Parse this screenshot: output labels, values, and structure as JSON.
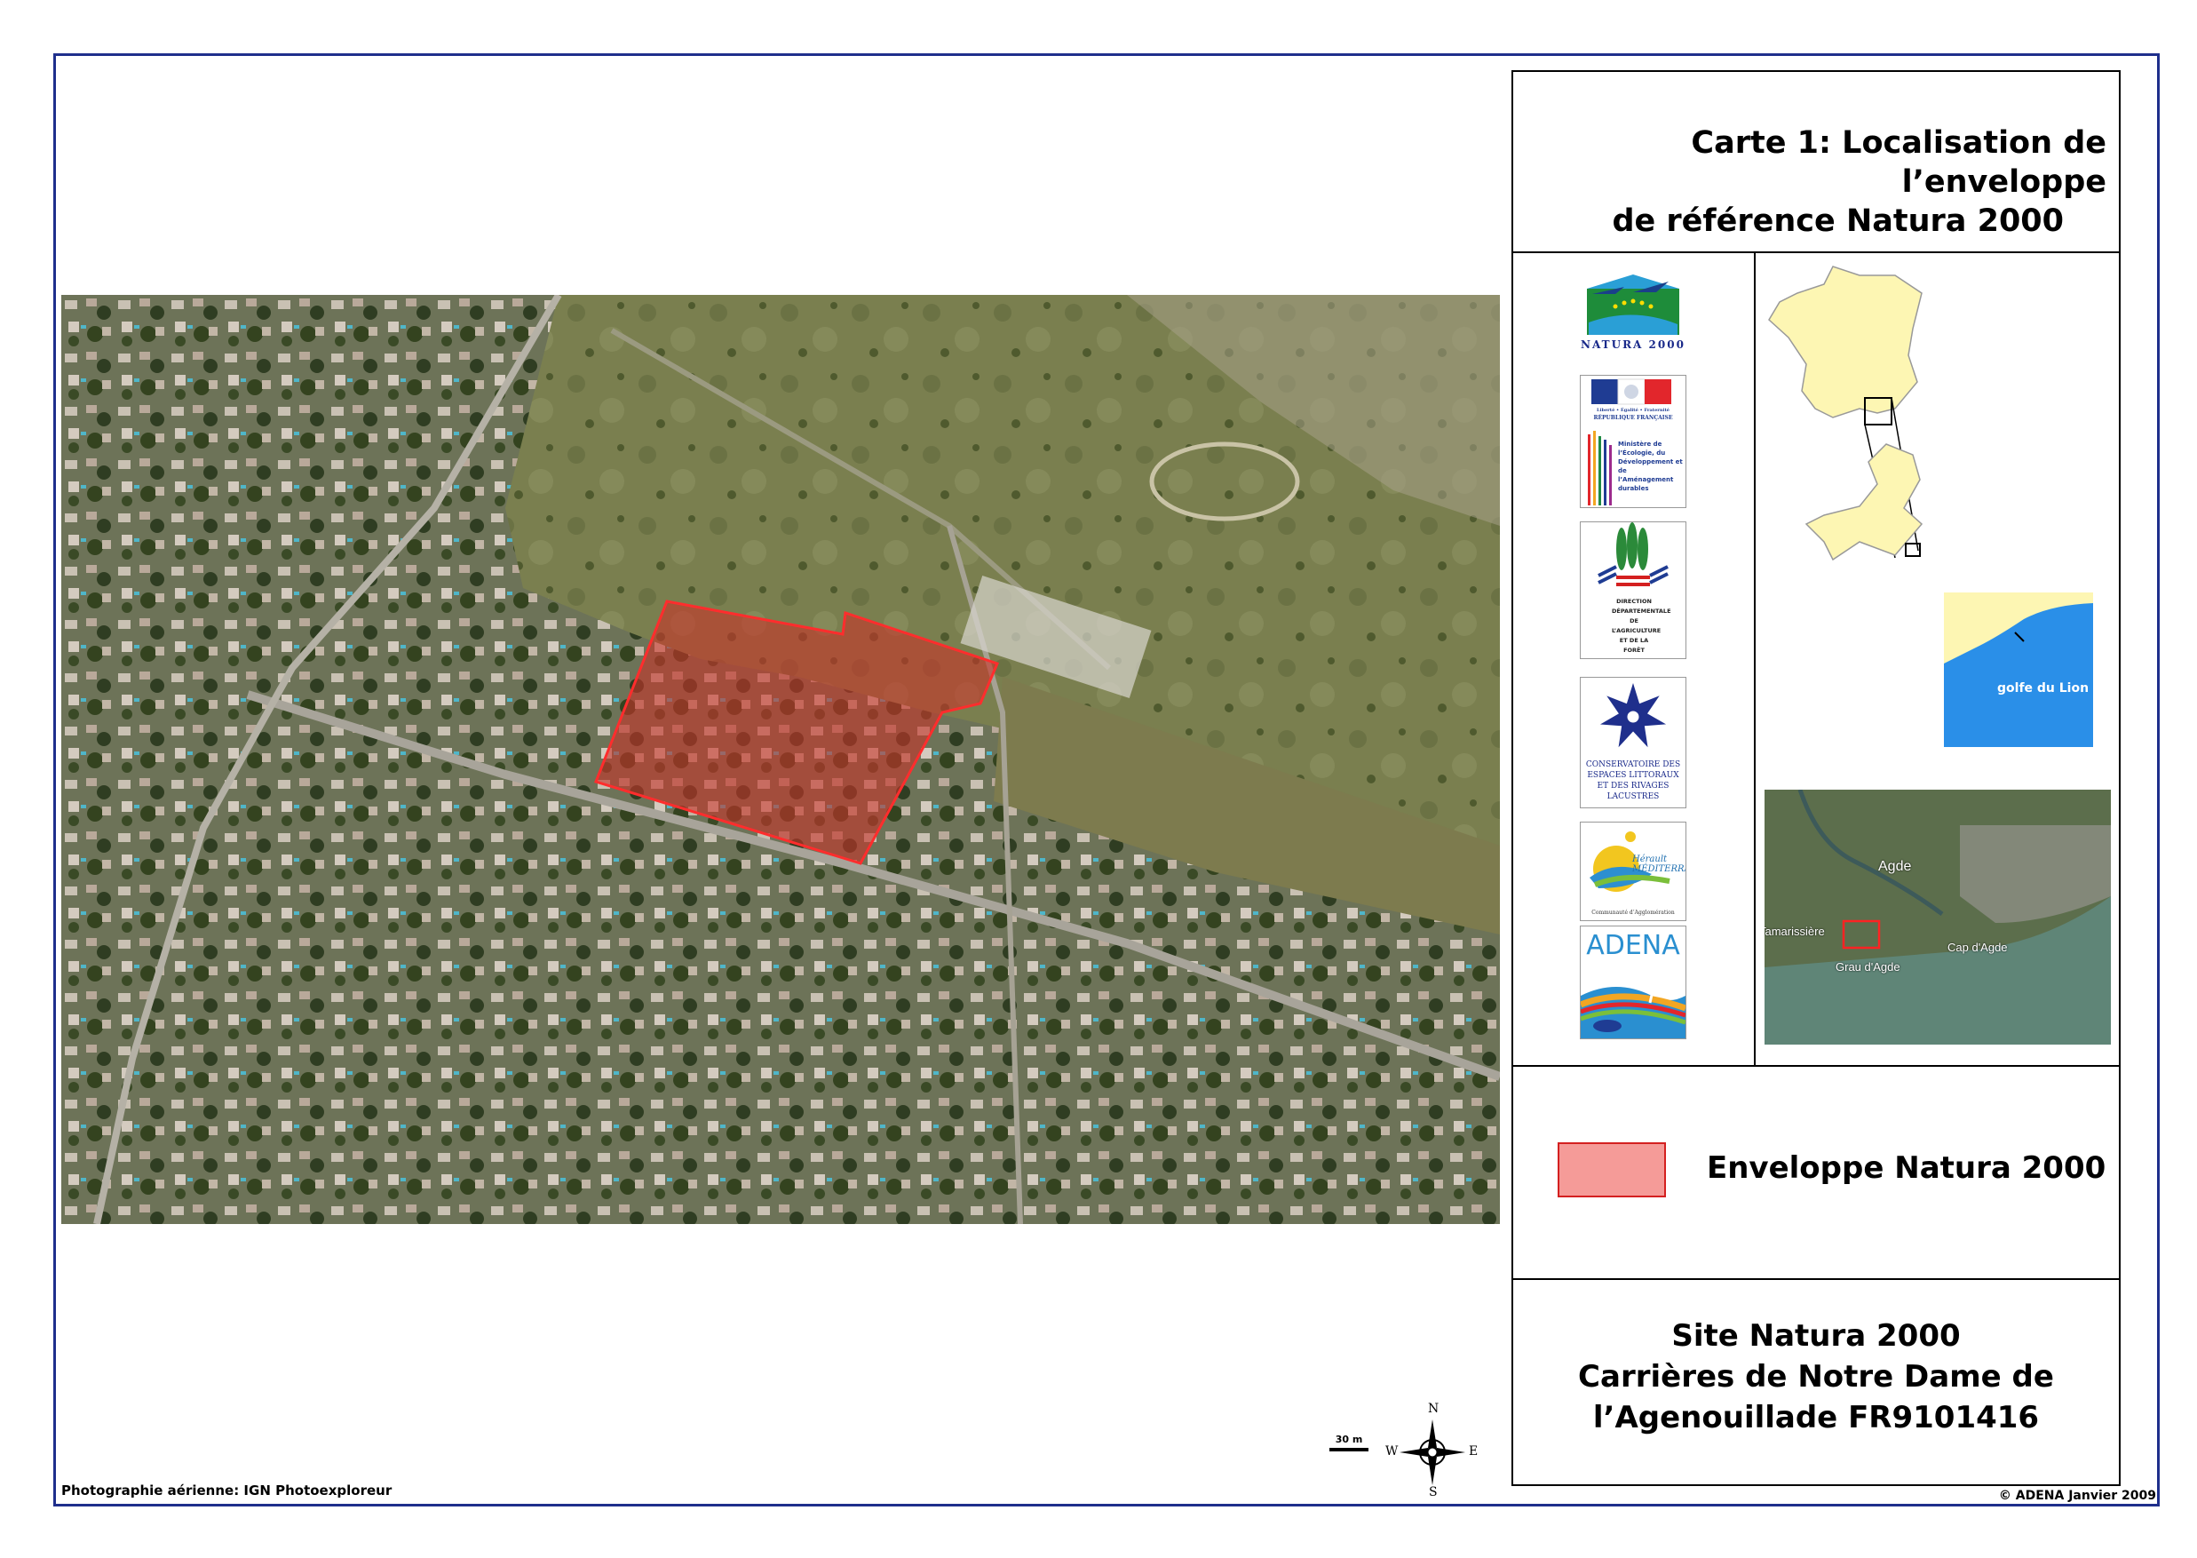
{
  "title": {
    "line1": "Carte 1: Localisation de l’enveloppe",
    "line2": "de référence Natura 2000"
  },
  "legend": {
    "label": "Enveloppe Natura 2000",
    "swatch_color": "#f59b98",
    "stroke_color": "#d42020"
  },
  "site": {
    "line1": "Site Natura 2000",
    "line2": "Carrières de Notre Dame de",
    "line3": "l’Agenouillade FR9101416"
  },
  "credit": "Photographie aérienne: IGN Photoexploreur",
  "copyright": "© ADENA Janvier 2009",
  "scale": {
    "label": "30 m"
  },
  "compass": {
    "n": "N",
    "s": "S",
    "e": "E",
    "w": "W"
  },
  "logos": {
    "natura": "NATURA 2000",
    "republique_motto": "Liberté • Égalité • Fraternité",
    "republique": "RÉPUBLIQUE FRANÇAISE",
    "ministere": "Ministère de l’Écologie, du Développement et de l’Aménagement durables",
    "ddaf": "DIRECTION DÉPARTEMENTALE DE L’AGRICULTURE ET DE LA FORÊT",
    "conservatoire": "CONSERVATOIRE DES ESPACES LITTORAUX ET DES RIVAGES LACUSTRES",
    "herault": "Hérault MÉDITERRANÉE",
    "herault_sub": "Communauté d’Agglomération",
    "adena": "ADENA"
  },
  "inset_map": {
    "labels": [
      "Agde",
      "Tamarissière",
      "Grau d'Agde",
      "Cap d'Agde"
    ],
    "sea_label": "golfe du Lion"
  }
}
